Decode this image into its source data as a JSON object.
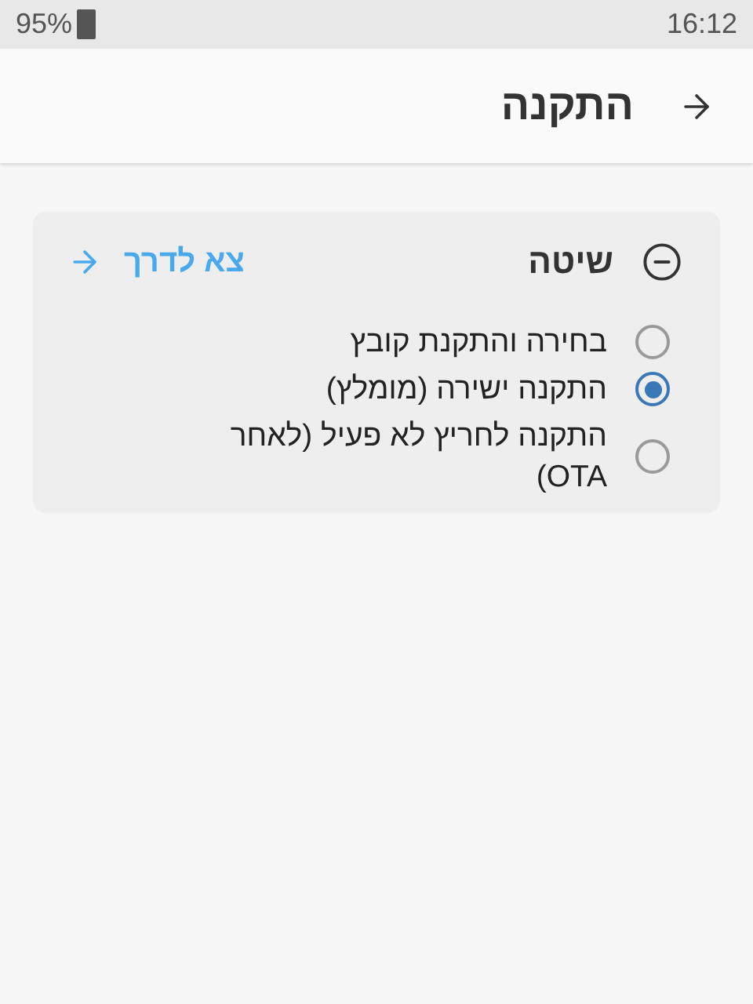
{
  "status_bar": {
    "battery": "95%",
    "time": "16:12"
  },
  "header": {
    "title": "התקנה"
  },
  "section": {
    "title": "שיטה",
    "expanded": true,
    "link": "צא לדרך",
    "options": [
      {
        "label": "בחירה והתקנת קובץ",
        "selected": false
      },
      {
        "label": "התקנה ישירה (מומלץ)",
        "selected": true
      },
      {
        "label": "התקנה לחריץ לא פעיל (לאחר OTA)",
        "selected": false
      }
    ]
  }
}
